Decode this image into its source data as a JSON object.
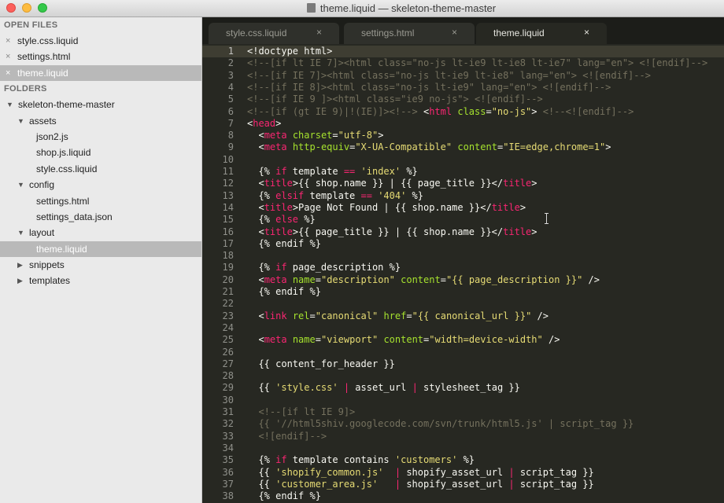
{
  "window": {
    "title": "theme.liquid — skeleton-theme-master"
  },
  "sidebar": {
    "open_files_header": "OPEN FILES",
    "open_files": [
      {
        "label": "style.css.liquid",
        "selected": false
      },
      {
        "label": "settings.html",
        "selected": false
      },
      {
        "label": "theme.liquid",
        "selected": true
      }
    ],
    "folders_header": "FOLDERS",
    "tree": [
      {
        "label": "skeleton-theme-master",
        "depth": 0,
        "type": "folder",
        "expanded": true,
        "selected": false
      },
      {
        "label": "assets",
        "depth": 1,
        "type": "folder",
        "expanded": true,
        "selected": false
      },
      {
        "label": "json2.js",
        "depth": 2,
        "type": "file",
        "selected": false
      },
      {
        "label": "shop.js.liquid",
        "depth": 2,
        "type": "file",
        "selected": false
      },
      {
        "label": "style.css.liquid",
        "depth": 2,
        "type": "file",
        "selected": false
      },
      {
        "label": "config",
        "depth": 1,
        "type": "folder",
        "expanded": true,
        "selected": false
      },
      {
        "label": "settings.html",
        "depth": 2,
        "type": "file",
        "selected": false
      },
      {
        "label": "settings_data.json",
        "depth": 2,
        "type": "file",
        "selected": false
      },
      {
        "label": "layout",
        "depth": 1,
        "type": "folder",
        "expanded": true,
        "selected": false
      },
      {
        "label": "theme.liquid",
        "depth": 2,
        "type": "file",
        "selected": true
      },
      {
        "label": "snippets",
        "depth": 1,
        "type": "folder",
        "expanded": false,
        "selected": false
      },
      {
        "label": "templates",
        "depth": 1,
        "type": "folder",
        "expanded": false,
        "selected": false
      }
    ]
  },
  "tabs": [
    {
      "label": "style.css.liquid",
      "active": false
    },
    {
      "label": "settings.html",
      "active": false
    },
    {
      "label": "theme.liquid",
      "active": true
    }
  ],
  "icons": {
    "close": "×",
    "expanded": "▼",
    "collapsed": "▶"
  },
  "colors": {
    "editor_bg": "#272822",
    "tag": "#f92672",
    "attr": "#a6e22e",
    "string": "#e6db74",
    "comment": "#75715e",
    "text": "#f8f8f2"
  },
  "editor": {
    "current_line": 1,
    "lines": [
      [
        [
          "p",
          "<!doctype html>"
        ]
      ],
      [
        [
          "c",
          "<!--[if lt IE 7]><html class=\"no-js lt-ie9 lt-ie8 lt-ie7\" lang=\"en\"> <![endif]-->"
        ]
      ],
      [
        [
          "c",
          "<!--[if IE 7]><html class=\"no-js lt-ie9 lt-ie8\" lang=\"en\"> <![endif]-->"
        ]
      ],
      [
        [
          "c",
          "<!--[if IE 8]><html class=\"no-js lt-ie9\" lang=\"en\"> <![endif]-->"
        ]
      ],
      [
        [
          "c",
          "<!--[if IE 9 ]><html class=\"ie9 no-js\"> <![endif]-->"
        ]
      ],
      [
        [
          "c",
          "<!--[if (gt IE 9)|!(IE)]><!--> "
        ],
        [
          "p",
          "<"
        ],
        [
          "t",
          "html"
        ],
        [
          "p",
          " "
        ],
        [
          "a",
          "class"
        ],
        [
          "p",
          "="
        ],
        [
          "s",
          "\"no-js\""
        ],
        [
          "p",
          "> "
        ],
        [
          "c",
          "<!--<![endif]-->"
        ]
      ],
      [
        [
          "p",
          "<"
        ],
        [
          "t",
          "head"
        ],
        [
          "p",
          ">"
        ]
      ],
      [
        [
          "p",
          "  <"
        ],
        [
          "t",
          "meta"
        ],
        [
          "p",
          " "
        ],
        [
          "a",
          "charset"
        ],
        [
          "p",
          "="
        ],
        [
          "s",
          "\"utf-8\""
        ],
        [
          "p",
          ">"
        ]
      ],
      [
        [
          "p",
          "  <"
        ],
        [
          "t",
          "meta"
        ],
        [
          "p",
          " "
        ],
        [
          "a",
          "http-equiv"
        ],
        [
          "p",
          "="
        ],
        [
          "s",
          "\"X-UA-Compatible\""
        ],
        [
          "p",
          " "
        ],
        [
          "a",
          "content"
        ],
        [
          "p",
          "="
        ],
        [
          "s",
          "\"IE=edge,chrome=1\""
        ],
        [
          "p",
          ">"
        ]
      ],
      [],
      [
        [
          "p",
          "  {% "
        ],
        [
          "k",
          "if"
        ],
        [
          "p",
          " template "
        ],
        [
          "k",
          "=="
        ],
        [
          "p",
          " "
        ],
        [
          "s",
          "'index'"
        ],
        [
          "p",
          " %}"
        ]
      ],
      [
        [
          "p",
          "  <"
        ],
        [
          "t",
          "title"
        ],
        [
          "p",
          ">{{ shop.name }} | {{ page_title }}</"
        ],
        [
          "t",
          "title"
        ],
        [
          "p",
          ">"
        ]
      ],
      [
        [
          "p",
          "  {% "
        ],
        [
          "k",
          "elsif"
        ],
        [
          "p",
          " template "
        ],
        [
          "k",
          "=="
        ],
        [
          "p",
          " "
        ],
        [
          "s",
          "'404'"
        ],
        [
          "p",
          " %}"
        ]
      ],
      [
        [
          "p",
          "  <"
        ],
        [
          "t",
          "title"
        ],
        [
          "p",
          ">Page Not Found | {{ shop.name }}</"
        ],
        [
          "t",
          "title"
        ],
        [
          "p",
          ">"
        ]
      ],
      [
        [
          "p",
          "  {% "
        ],
        [
          "k",
          "else"
        ],
        [
          "p",
          " %}"
        ]
      ],
      [
        [
          "p",
          "  <"
        ],
        [
          "t",
          "title"
        ],
        [
          "p",
          ">{{ page_title }} | {{ shop.name }}</"
        ],
        [
          "t",
          "title"
        ],
        [
          "p",
          ">"
        ]
      ],
      [
        [
          "p",
          "  {% endif %}"
        ]
      ],
      [],
      [
        [
          "p",
          "  {% "
        ],
        [
          "k",
          "if"
        ],
        [
          "p",
          " page_description %}"
        ]
      ],
      [
        [
          "p",
          "  <"
        ],
        [
          "t",
          "meta"
        ],
        [
          "p",
          " "
        ],
        [
          "a",
          "name"
        ],
        [
          "p",
          "="
        ],
        [
          "s",
          "\"description\""
        ],
        [
          "p",
          " "
        ],
        [
          "a",
          "content"
        ],
        [
          "p",
          "="
        ],
        [
          "s",
          "\"{{ page_description }}\""
        ],
        [
          "p",
          " />"
        ]
      ],
      [
        [
          "p",
          "  {% endif %}"
        ]
      ],
      [],
      [
        [
          "p",
          "  <"
        ],
        [
          "t",
          "link"
        ],
        [
          "p",
          " "
        ],
        [
          "a",
          "rel"
        ],
        [
          "p",
          "="
        ],
        [
          "s",
          "\"canonical\""
        ],
        [
          "p",
          " "
        ],
        [
          "a",
          "href"
        ],
        [
          "p",
          "="
        ],
        [
          "s",
          "\"{{ canonical_url }}\""
        ],
        [
          "p",
          " />"
        ]
      ],
      [],
      [
        [
          "p",
          "  <"
        ],
        [
          "t",
          "meta"
        ],
        [
          "p",
          " "
        ],
        [
          "a",
          "name"
        ],
        [
          "p",
          "="
        ],
        [
          "s",
          "\"viewport\""
        ],
        [
          "p",
          " "
        ],
        [
          "a",
          "content"
        ],
        [
          "p",
          "="
        ],
        [
          "s",
          "\"width=device-width\""
        ],
        [
          "p",
          " />"
        ]
      ],
      [],
      [
        [
          "p",
          "  {{ content_for_header }}"
        ]
      ],
      [],
      [
        [
          "p",
          "  {{ "
        ],
        [
          "s",
          "'style.css'"
        ],
        [
          "p",
          " "
        ],
        [
          "k",
          "|"
        ],
        [
          "p",
          " asset_url "
        ],
        [
          "k",
          "|"
        ],
        [
          "p",
          " stylesheet_tag }}"
        ]
      ],
      [],
      [
        [
          "c",
          "  <!--[if lt IE 9]>"
        ]
      ],
      [
        [
          "c",
          "  {{ '//html5shiv.googlecode.com/svn/trunk/html5.js' | script_tag }}"
        ]
      ],
      [
        [
          "c",
          "  <![endif]-->"
        ]
      ],
      [],
      [
        [
          "p",
          "  {% "
        ],
        [
          "k",
          "if"
        ],
        [
          "p",
          " template contains "
        ],
        [
          "s",
          "'customers'"
        ],
        [
          "p",
          " %}"
        ]
      ],
      [
        [
          "p",
          "  {{ "
        ],
        [
          "s",
          "'shopify_common.js'"
        ],
        [
          "p",
          "  "
        ],
        [
          "k",
          "|"
        ],
        [
          "p",
          " shopify_asset_url "
        ],
        [
          "k",
          "|"
        ],
        [
          "p",
          " script_tag }}"
        ]
      ],
      [
        [
          "p",
          "  {{ "
        ],
        [
          "s",
          "'customer_area.js'"
        ],
        [
          "p",
          "   "
        ],
        [
          "k",
          "|"
        ],
        [
          "p",
          " shopify_asset_url "
        ],
        [
          "k",
          "|"
        ],
        [
          "p",
          " script_tag }}"
        ]
      ],
      [
        [
          "p",
          "  {% endif %}"
        ]
      ]
    ]
  }
}
